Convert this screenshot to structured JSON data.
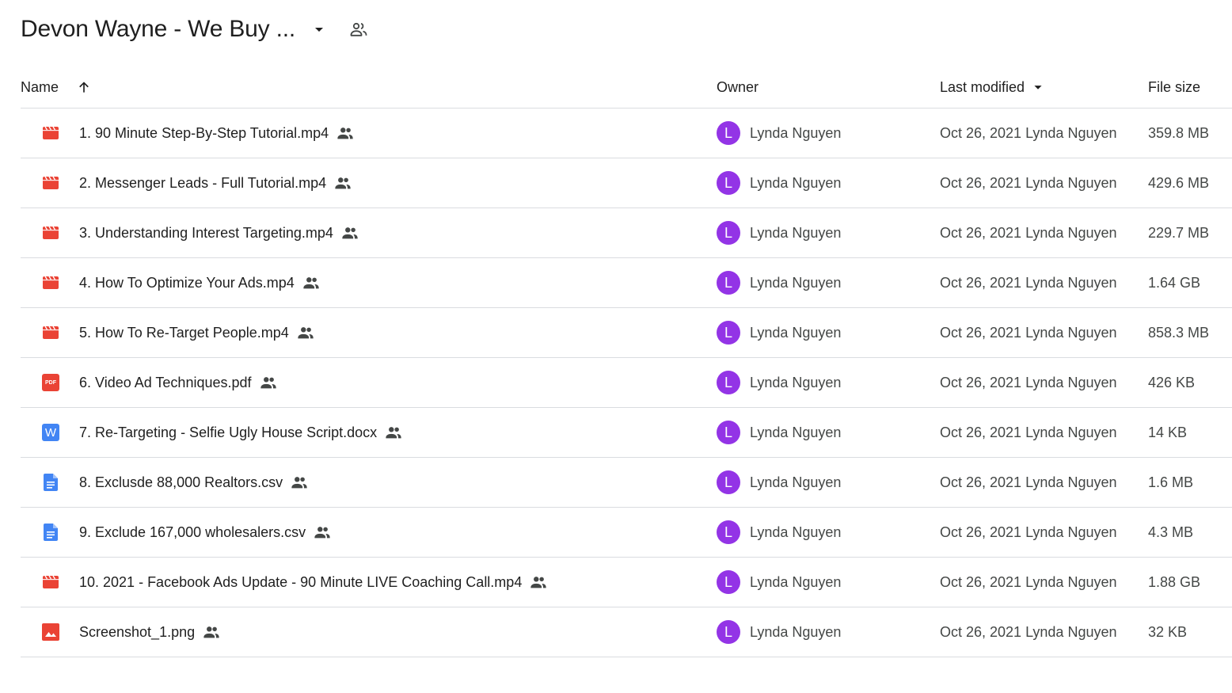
{
  "header": {
    "title": "Devon Wayne - We Buy ...",
    "dropdown_icon": "arrow-drop-down-icon",
    "share_icon": "shared-people-icon"
  },
  "columns": {
    "name": "Name",
    "owner": "Owner",
    "last_modified": "Last modified",
    "file_size": "File size",
    "name_sort": "ascending",
    "modified_sort": "descending-caret"
  },
  "colors": {
    "video": "#ea4335",
    "pdf": "#ea4335",
    "word": "#4285f4",
    "doc": "#4285f4",
    "image": "#ea4335",
    "avatar": "#9334e6"
  },
  "files": [
    {
      "type": "video",
      "name": "1. 90 Minute Step-By-Step Tutorial.mp4",
      "owner_initial": "L",
      "owner": "Lynda Nguyen",
      "modified": "Oct 26, 2021 Lynda Nguyen",
      "size": "359.8 MB"
    },
    {
      "type": "video",
      "name": "2. Messenger Leads - Full Tutorial.mp4",
      "owner_initial": "L",
      "owner": "Lynda Nguyen",
      "modified": "Oct 26, 2021 Lynda Nguyen",
      "size": "429.6 MB"
    },
    {
      "type": "video",
      "name": "3. Understanding Interest Targeting.mp4",
      "owner_initial": "L",
      "owner": "Lynda Nguyen",
      "modified": "Oct 26, 2021 Lynda Nguyen",
      "size": "229.7 MB"
    },
    {
      "type": "video",
      "name": "4. How To Optimize Your Ads.mp4",
      "owner_initial": "L",
      "owner": "Lynda Nguyen",
      "modified": "Oct 26, 2021 Lynda Nguyen",
      "size": "1.64 GB"
    },
    {
      "type": "video",
      "name": "5. How To Re-Target People.mp4",
      "owner_initial": "L",
      "owner": "Lynda Nguyen",
      "modified": "Oct 26, 2021 Lynda Nguyen",
      "size": "858.3 MB"
    },
    {
      "type": "pdf",
      "name": "6. Video Ad Techniques.pdf",
      "owner_initial": "L",
      "owner": "Lynda Nguyen",
      "modified": "Oct 26, 2021 Lynda Nguyen",
      "size": "426 KB",
      "icon_text": "PDF"
    },
    {
      "type": "word",
      "name": "7. Re-Targeting - Selfie Ugly House Script.docx",
      "owner_initial": "L",
      "owner": "Lynda Nguyen",
      "modified": "Oct 26, 2021 Lynda Nguyen",
      "size": "14 KB",
      "icon_text": "W"
    },
    {
      "type": "doc",
      "name": "8. Exclusde 88,000 Realtors.csv",
      "owner_initial": "L",
      "owner": "Lynda Nguyen",
      "modified": "Oct 26, 2021 Lynda Nguyen",
      "size": "1.6 MB"
    },
    {
      "type": "doc",
      "name": "9. Exclude 167,000 wholesalers.csv",
      "owner_initial": "L",
      "owner": "Lynda Nguyen",
      "modified": "Oct 26, 2021 Lynda Nguyen",
      "size": "4.3 MB"
    },
    {
      "type": "video",
      "name": "10. 2021 - Facebook Ads Update - 90 Minute LIVE Coaching Call.mp4",
      "owner_initial": "L",
      "owner": "Lynda Nguyen",
      "modified": "Oct 26, 2021 Lynda Nguyen",
      "size": "1.88 GB"
    },
    {
      "type": "image",
      "name": "Screenshot_1.png",
      "owner_initial": "L",
      "owner": "Lynda Nguyen",
      "modified": "Oct 26, 2021 Lynda Nguyen",
      "size": "32 KB"
    }
  ]
}
